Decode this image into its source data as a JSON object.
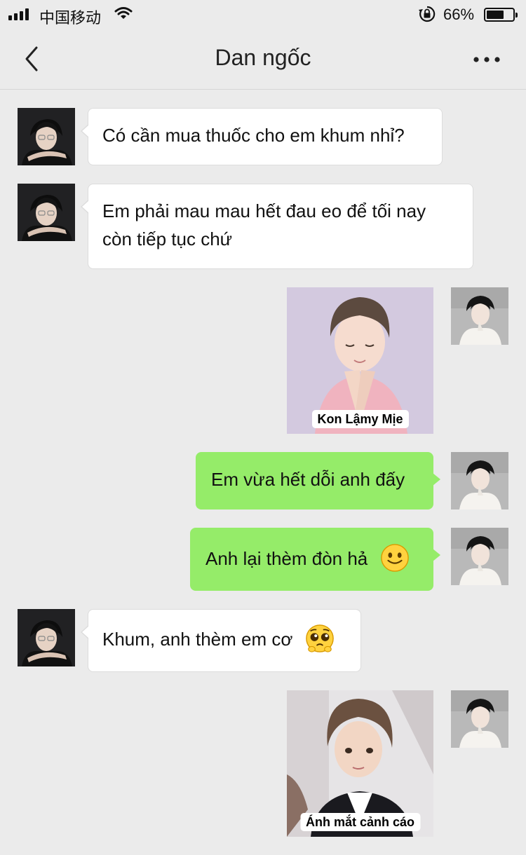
{
  "status_bar": {
    "carrier": "中国移动",
    "battery_percent": "66%",
    "battery_level": 0.66,
    "icons": [
      "signal-bars-icon",
      "wifi-icon",
      "orientation-lock-icon",
      "battery-icon"
    ]
  },
  "nav": {
    "title": "Dan ngốc",
    "back_icon": "chevron-left-icon",
    "more_icon": "more-dots-icon"
  },
  "messages": [
    {
      "from": "other",
      "type": "text",
      "text": "Có cần mua thuốc cho em khum nhỉ?"
    },
    {
      "from": "other",
      "type": "text",
      "lines": [
        "Em phải mau mau hết đau eo để tối nay",
        "còn tiếp tục chứ"
      ]
    },
    {
      "from": "me",
      "type": "sticker",
      "caption": "Kon Lậmy Mịe"
    },
    {
      "from": "me",
      "type": "text",
      "text": "Em vừa hết dỗi anh đấy"
    },
    {
      "from": "me",
      "type": "text",
      "text": "Anh lại thèm đòn hả",
      "emoji": "smiling-face-emoji"
    },
    {
      "from": "other",
      "type": "text",
      "text": "Khum, anh thèm em cơ",
      "emoji": "pleading-face-emoji"
    },
    {
      "from": "me",
      "type": "sticker",
      "caption": "Ánh mắt cảnh cáo"
    }
  ],
  "colors": {
    "background": "#ebebeb",
    "outgoing_bubble": "#95ec69",
    "incoming_bubble": "#ffffff"
  }
}
